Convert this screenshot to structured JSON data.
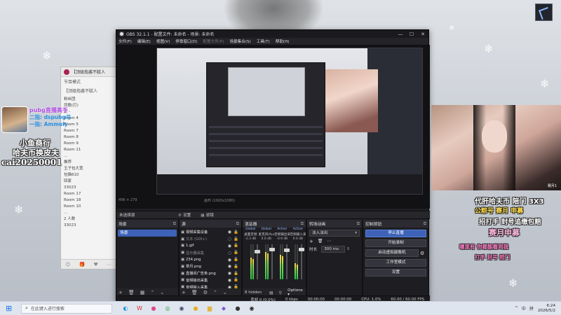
{
  "chat": {
    "title": "【顶级捣酱不腻人",
    "subtitle": "节目模式",
    "pinned": "【顶级捣酱不腻人",
    "items": [
      "粉丝团",
      "凤歌(打)",
      "麦 -",
      "Room 4",
      "Room 5",
      "Room 7",
      "Room 8",
      "Room 9",
      "Room 11",
      "...",
      "推荐",
      "玉子包大宽",
      "包猫610",
      "回家",
      "33023",
      "Room 17",
      "Room 18",
      "Room 10",
      "...",
      "2 人数",
      "33023"
    ],
    "footer_icons": [
      "emoji-icon",
      "gift-icon",
      "heart-icon",
      "more-icon"
    ]
  },
  "promo_left": {
    "line1": "pubg直播高手",
    "line2": "二指: dspubg号",
    "line3": "一指: Ammoly",
    "big1": "小鱼商行",
    "big2": "哈夫币换皮夫",
    "big3": "cai20250001"
  },
  "obs": {
    "title": "OBS 32.1.1 - 配置文件: 未命名 - 场景: 未命名",
    "menu": [
      "文件(F)",
      "编辑(E)",
      "视图(V)",
      "停靠窗口(D)",
      "配置文件(P)",
      "场景集合(S)",
      "工具(T)",
      "帮助(H)"
    ],
    "menu_disabled_index": 4,
    "no_source": "未选择源",
    "props_label": "设置",
    "filters_label": "滤镜",
    "docks": {
      "scenes": {
        "title": "场景",
        "items": [
          "场景"
        ]
      },
      "sources": {
        "title": "源",
        "items": [
          {
            "label": "视频采集设备",
            "visible": true
          },
          {
            "label": "文本 (GDI+)",
            "visible": false
          },
          {
            "label": "1.gif",
            "visible": true
          },
          {
            "label": "显示器采集",
            "visible": false
          },
          {
            "label": "234.png",
            "visible": true
          },
          {
            "label": "草月.png",
            "visible": true
          },
          {
            "label": "直播间广告条.png",
            "visible": true
          },
          {
            "label": "音频输出采集",
            "visible": true
          },
          {
            "label": "音频输入采集",
            "visible": true
          },
          {
            "label": "游戏采集",
            "visible": true
          }
        ]
      },
      "mixer": {
        "title": "混音器",
        "tabs": [
          "Global",
          "Global",
          "Active",
          "Active"
        ],
        "channel_names": [
          "桌面音频",
          "麦克风/Aux",
          "音频输出采集",
          "音频输入采集"
        ],
        "db": [
          "-2.3 dB",
          "0.0 dB",
          "-0.9 dB",
          "0.0 dB"
        ],
        "levels": [
          0.62,
          0.78,
          0.7,
          0.45
        ],
        "fader": [
          0.85,
          0.9,
          0.88,
          0.9
        ],
        "hidden_count": "8 hidden",
        "options_label": "Options"
      },
      "transitions": {
        "title": "转场动画",
        "selected": "淡入淡出",
        "duration_label": "时长",
        "duration_value": "300 ms"
      },
      "controls": {
        "title": "控制按钮",
        "buttons": [
          "停止直播",
          "开始录制",
          "启动虚拟摄像机",
          "工作室模式",
          "设置"
        ],
        "active_index": 0
      }
    },
    "preview": {
      "zoom_text": "496 × 279",
      "mid_text": "画布 (1920x1080)"
    },
    "status": {
      "dropped": "丢帧 0 (0.0%)",
      "bitrate": "0 kbps",
      "rec_time": "00:00:00",
      "stream_time": "00:00:00",
      "cpu": "CPU: 1.0%",
      "fps": "60.00 / 60.00 FPS"
    }
  },
  "promo_right": {
    "line1": "代肝哈夫币 陪门 3X3",
    "line2": "公粽号 赛月 申募",
    "line3": "招打手 封号追缴包赔",
    "line4": "赛月申募",
    "line5": "哪里有 你都能看到我",
    "line6": "打手 封号 陪门",
    "cam_tag": "赛月1"
  },
  "side_cam_caption": "赛月",
  "taskbar": {
    "search_placeholder": "在此键入进行搜索",
    "time": "6:24",
    "date": "2026/5/2",
    "tray_items": [
      "^",
      "中",
      "拼"
    ],
    "app_icons": [
      {
        "name": "edge-icon",
        "glyph": "◐",
        "color": "#1b8fe0"
      },
      {
        "name": "app-w-icon",
        "glyph": "W",
        "color": "#e0302a"
      },
      {
        "name": "app-pink-icon",
        "glyph": "●",
        "color": "#e04a8a"
      },
      {
        "name": "chrome-icon",
        "glyph": "◎",
        "color": "#2fa04a"
      },
      {
        "name": "steam-icon",
        "glyph": "◉",
        "color": "#3b4e6e"
      },
      {
        "name": "app-yellow-icon",
        "glyph": "●",
        "color": "#e0b020"
      },
      {
        "name": "folder-icon",
        "glyph": "▆",
        "color": "#e2b44a"
      },
      {
        "name": "game-icon",
        "glyph": "◆",
        "color": "#7b5bd1"
      },
      {
        "name": "app-cat-icon",
        "glyph": "●",
        "color": "#333333"
      },
      {
        "name": "obs-icon",
        "glyph": "◉",
        "color": "#222222"
      }
    ]
  }
}
